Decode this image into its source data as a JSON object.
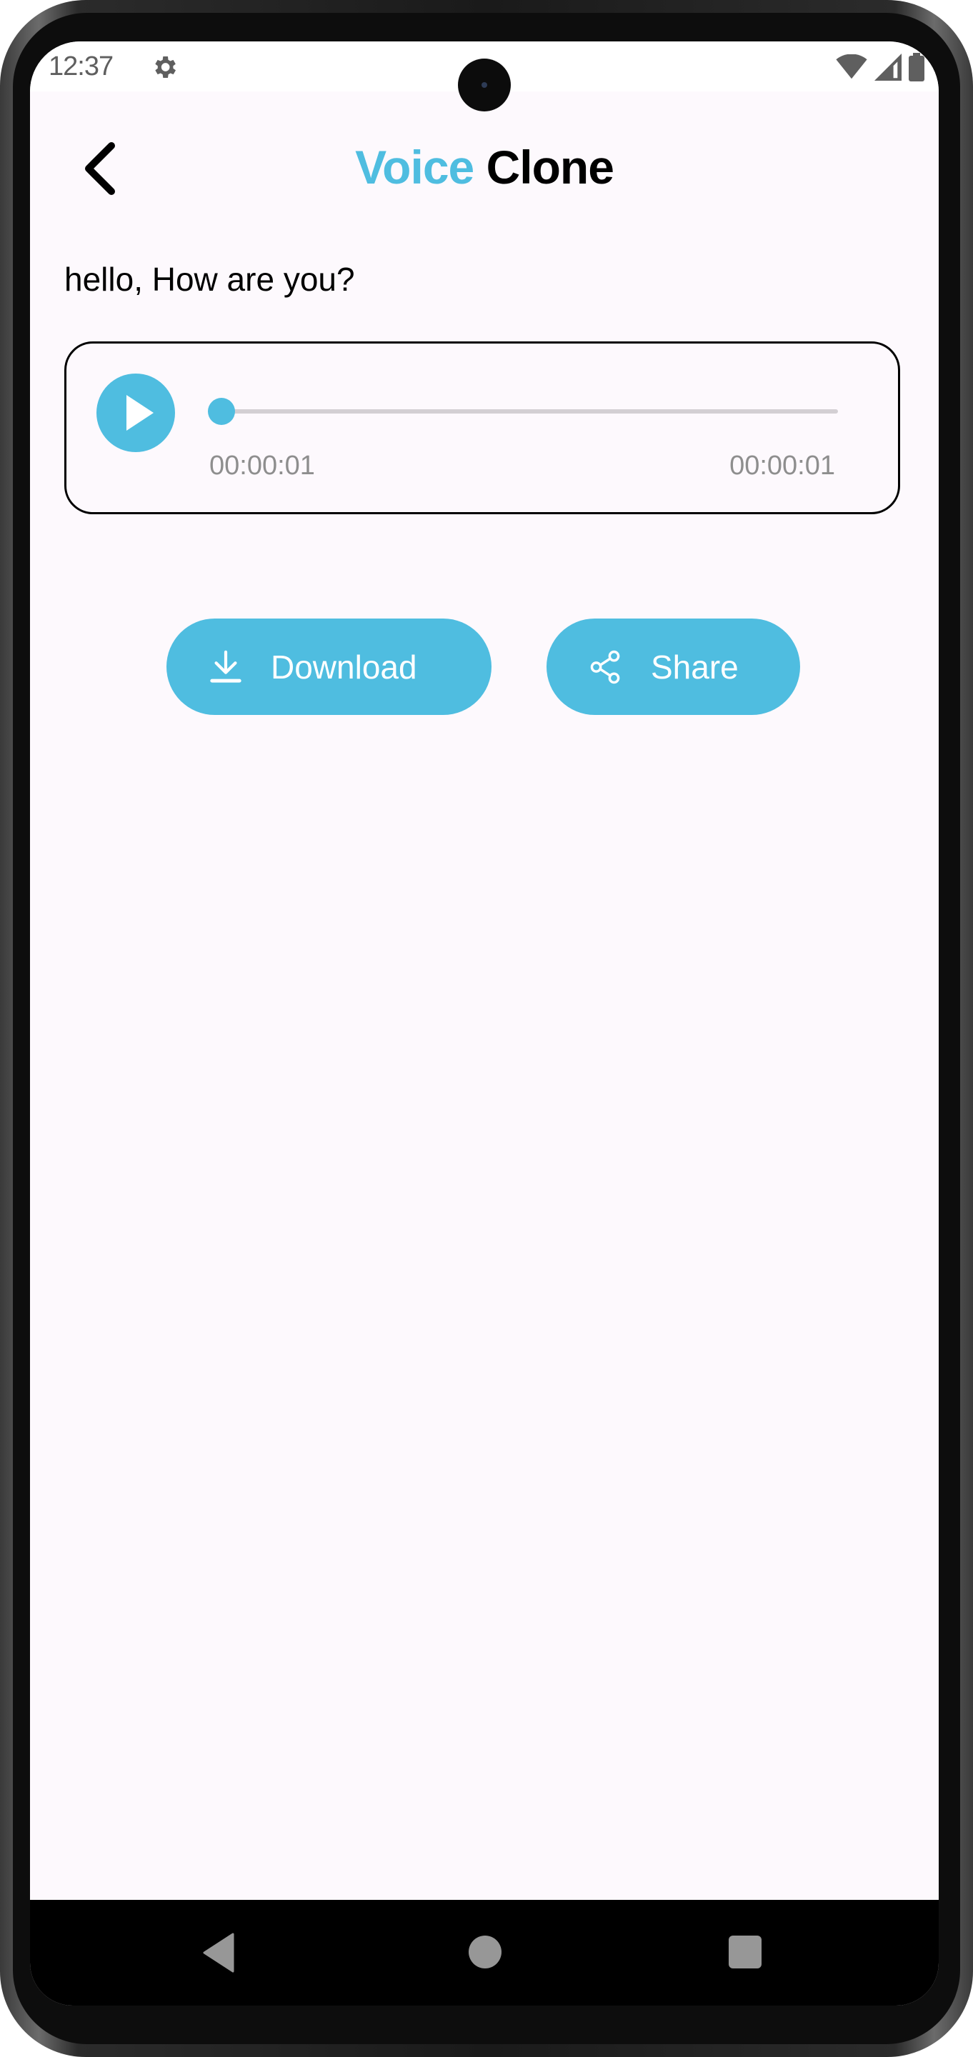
{
  "status_bar": {
    "time": "12:37",
    "icons": [
      "settings-gear-icon",
      "wifi-icon",
      "cell-signal-icon",
      "battery-icon"
    ]
  },
  "app_bar": {
    "back_icon": "chevron-left-icon",
    "title_accent": "Voice",
    "title_rest": "Clone"
  },
  "prompt_text": "hello, How are you?",
  "player": {
    "play_icon": "play-icon",
    "current_time": "00:00:01",
    "total_time": "00:00:01",
    "progress_fraction": 0.0
  },
  "actions": {
    "download_label": "Download",
    "download_icon": "download-icon",
    "share_label": "Share",
    "share_icon": "share-icon"
  },
  "nav_bar": {
    "back": "nav-back-icon",
    "home": "nav-home-icon",
    "recents": "nav-recents-icon"
  },
  "colors": {
    "accent": "#4fbde0",
    "background": "#fdf9fd",
    "text": "#000000",
    "muted_text": "#8e8e8e",
    "track": "#d3cfd3"
  }
}
